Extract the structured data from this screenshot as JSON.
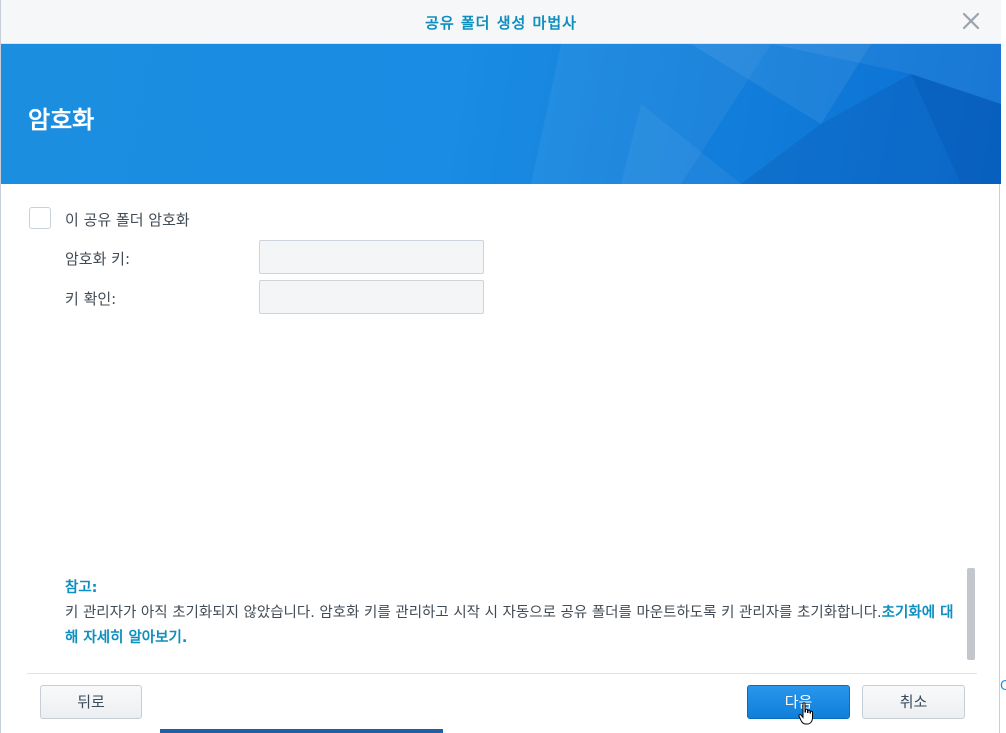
{
  "window": {
    "title": "공유 폴더 생성 마법사"
  },
  "banner": {
    "title": "암호화"
  },
  "encrypt": {
    "checkbox_label": "이 공유 폴더 암호화",
    "checked": false,
    "key_label": "암호화 키:",
    "key_value": "",
    "confirm_label": "키 확인:",
    "confirm_value": ""
  },
  "note": {
    "title": "참고:",
    "body": "키 관리자가 아직 초기화되지 않았습니다. 암호화 키를 관리하고 시작 시 자동으로 공유 폴더를 마운트하도록 키 관리자를 초기화합니다.",
    "link": "초기화에 대해 자세히 알아보기."
  },
  "footer": {
    "back_label": "뒤로",
    "next_label": "다음",
    "cancel_label": "취소"
  },
  "icons": {
    "close": "close-icon",
    "cursor": "hand-pointer-cursor"
  },
  "colors": {
    "accent": "#0f8fbf",
    "banner": "#1a8ce3",
    "primary_button": "#1a88e0"
  },
  "edge_fragment": "C"
}
